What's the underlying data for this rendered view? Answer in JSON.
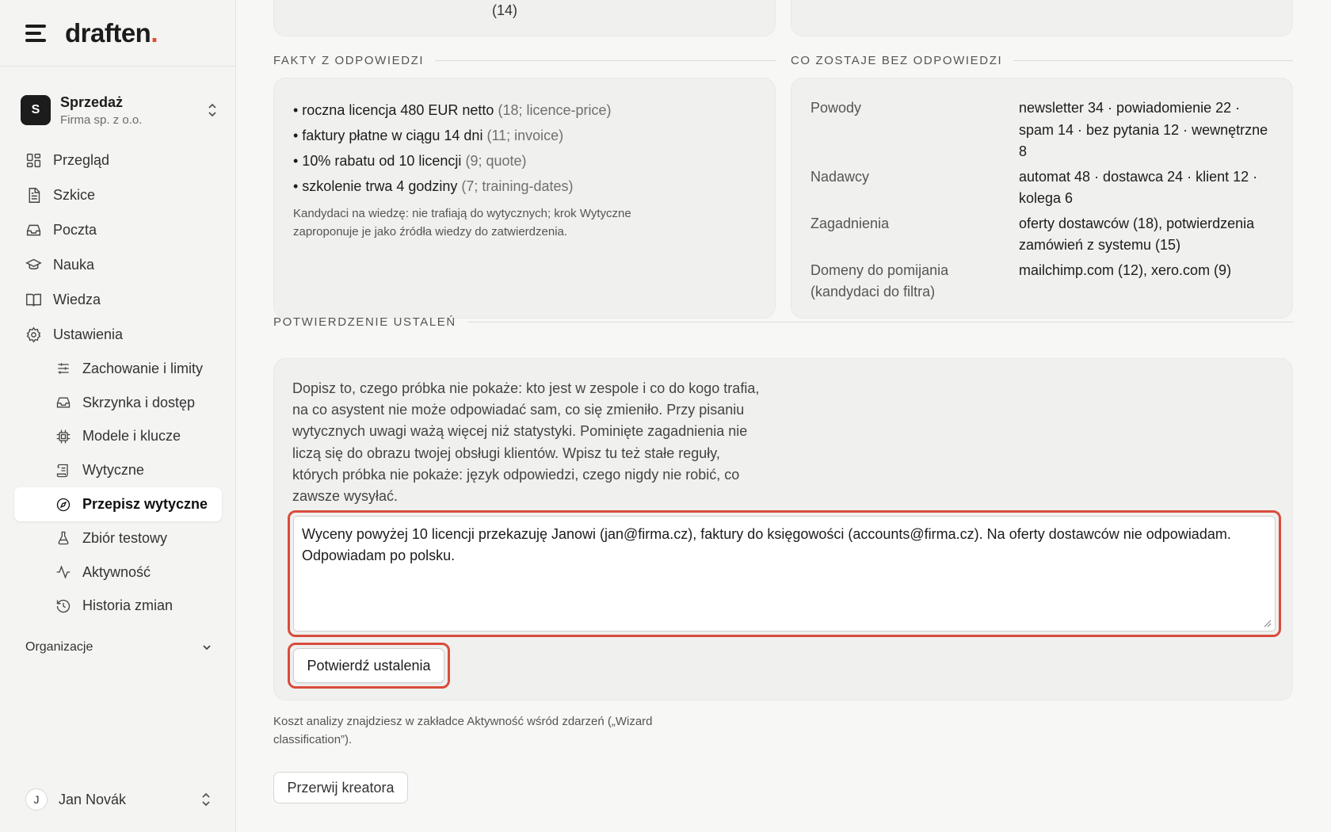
{
  "brand": {
    "name": "draften",
    "dot": "."
  },
  "workspace": {
    "initial": "S",
    "name": "Sprzedaż",
    "company": "Firma sp. z o.o."
  },
  "nav": {
    "items": [
      {
        "label": "Przegląd",
        "icon": "dashboard-icon"
      },
      {
        "label": "Szkice",
        "icon": "document-icon"
      },
      {
        "label": "Poczta",
        "icon": "inbox-icon"
      },
      {
        "label": "Nauka",
        "icon": "graduation-cap-icon"
      },
      {
        "label": "Wiedza",
        "icon": "book-icon"
      },
      {
        "label": "Ustawienia",
        "icon": "gear-icon"
      }
    ],
    "settings_items": [
      {
        "label": "Zachowanie i limity",
        "icon": "sliders-icon"
      },
      {
        "label": "Skrzynka i dostęp",
        "icon": "inbox-icon"
      },
      {
        "label": "Modele i klucze",
        "icon": "chip-icon"
      },
      {
        "label": "Wytyczne",
        "icon": "scroll-icon"
      },
      {
        "label": "Przepisz wytyczne",
        "icon": "compass-icon",
        "active": true
      },
      {
        "label": "Zbiór testowy",
        "icon": "flask-icon"
      },
      {
        "label": "Aktywność",
        "icon": "activity-icon"
      },
      {
        "label": "Historia zmian",
        "icon": "history-icon"
      }
    ],
    "organizations_label": "Organizacje"
  },
  "user": {
    "initial": "J",
    "name": "Jan Novák"
  },
  "top": {
    "count": "(14)"
  },
  "facts": {
    "title": "FAKTY Z ODPOWIEDZI",
    "items": [
      {
        "text": "• roczna licencja 480 EUR netto",
        "meta": "(18; licence-price)"
      },
      {
        "text": "• faktury płatne w ciągu 14 dni",
        "meta": "(11; invoice)"
      },
      {
        "text": "• 10% rabatu od 10 licencji",
        "meta": "(9; quote)"
      },
      {
        "text": "• szkolenie trwa 4 godziny",
        "meta": "(7; training-dates)"
      }
    ],
    "note": "Kandydaci na wiedzę: nie trafiają do wytycznych; krok Wytyczne zaproponuje je jako źródła wiedzy do zatwierdzenia."
  },
  "unanswered": {
    "title": "CO ZOSTAJE BEZ ODPOWIEDZI",
    "rows": [
      {
        "key": "Powody",
        "value": "newsletter 34 · powiadomienie 22 · spam 14 · bez pytania 12 · wewnętrzne 8"
      },
      {
        "key": "Nadawcy",
        "value": "automat 48 · dostawca 24 · klient 12 · kolega 6"
      },
      {
        "key": "Zagadnienia",
        "value": "oferty dostawców (18), potwierdzenia zamówień z systemu (15)"
      },
      {
        "key": "Domeny do pomijania (kandydaci do filtra)",
        "value": "mailchimp.com (12), xero.com (9)"
      }
    ]
  },
  "confirm": {
    "title": "POTWIERDZENIE USTALEŃ",
    "instructions": "Dopisz to, czego próbka nie pokaże: kto jest w zespole i co do kogo trafia, na co asystent nie może odpowiadać sam, co się zmieniło. Przy pisaniu wytycznych uwagi ważą więcej niż statystyki. Pominięte zagadnienia nie liczą się do obrazu twojej obsługi klientów. Wpisz tu też stałe reguły, których próbka nie pokaże: język odpowiedzi, czego nigdy nie robić, co zawsze wysyłać.",
    "textarea_value": "Wyceny powyżej 10 licencji przekazuję Janowi (jan@firma.cz), faktury do księgowości (accounts@firma.cz). Na oferty dostawców nie odpowiadam. Odpowiadam po polsku.",
    "button_label": "Potwierdź ustalenia"
  },
  "cost_note": "Koszt analizy znajdziesz w zakładce Aktywność wśród zdarzeń („Wizard classification”).",
  "abort_button": "Przerwij kreatora",
  "colors": {
    "accent": "#e14b2b",
    "highlight": "#d94c3c",
    "card": "#f0f0ee"
  }
}
